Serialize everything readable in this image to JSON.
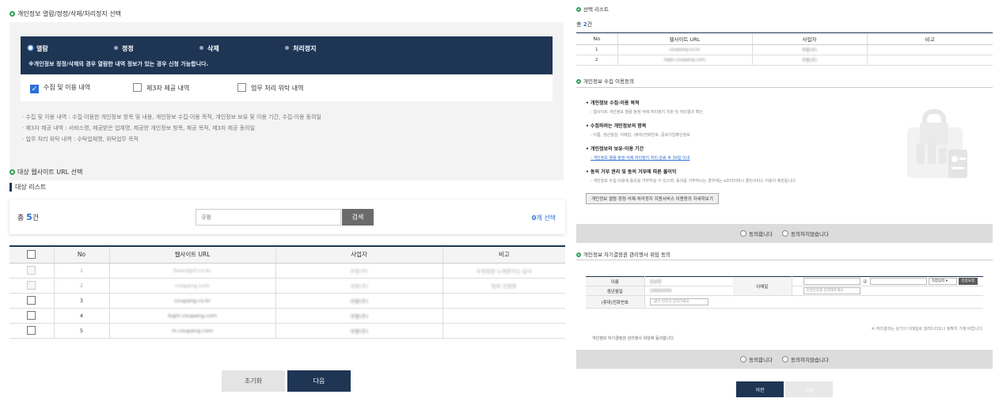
{
  "left": {
    "section1_title": "개인정보 열람/정정/삭제/처리정지 선택",
    "options": [
      "열람",
      "정정",
      "삭제",
      "처리정지"
    ],
    "notice": "※개인정보 정정/삭제의 경우 열람한 내역 정보가 있는 경우 신청 가능합니다.",
    "checks": [
      "수집 및 이용 내역",
      "제3자 제공 내역",
      "업무 처리 위탁 내역"
    ],
    "desc": [
      "· 수집 및 이용 내역 : 수집·이용한 개인정보 항목 및 내용, 개인정보 수집·이용 목적, 개인정보 보유 및 이용 기간, 수집·이용 동의일",
      "· 제3자 제공 내역 : 서비스명, 제공받은 업체명, 제공한 개인정보 항목, 제공 목적, 제3자 제공 동의일",
      "· 업무 처리 위탁 내역 : 수탁업체명, 위탁업무 목적"
    ],
    "section2_title": "대상 웹사이트 URL 선택",
    "list_title": "대상 리스트",
    "total_prefix": "총",
    "total_count": "5",
    "total_suffix": "건",
    "search_placeholder": "쿠팡",
    "search_button": "검색",
    "selected_count": "0",
    "selected_suffix": "개 선택",
    "table_headers": [
      "No",
      "웹사이트 URL",
      "사업자",
      "비고"
    ],
    "rows": [
      {
        "no": "1",
        "url": "boardgirl.co.kr",
        "biz": "쿠팡(주)",
        "note": "부정회원 노래방지도·감사"
      },
      {
        "no": "2",
        "url": "coupang.com",
        "biz": "쿠팡(주)",
        "note": "탈퇴 진행중"
      },
      {
        "no": "3",
        "url": "coupang.co.kr",
        "biz": "쿠팡(주)",
        "note": ""
      },
      {
        "no": "4",
        "url": "login.coupang.com",
        "biz": "쿠팡(주)",
        "note": ""
      },
      {
        "no": "5",
        "url": "m.coupang.com",
        "biz": "쿠팡(주)",
        "note": ""
      }
    ],
    "reset_button": "초기화",
    "next_button": "다음"
  },
  "right": {
    "selected_title": "선택 리스트",
    "total_prefix": "총",
    "total_count": "2",
    "total_suffix": "건",
    "headers": [
      "No",
      "웹사이트 URL",
      "사업자",
      "비고"
    ],
    "rows": [
      {
        "no": "1",
        "url": "coupang.co.kr",
        "biz": "쿠팡(주)",
        "note": ""
      },
      {
        "no": "2",
        "url": "login.coupang.com",
        "biz": "쿠팡(주)",
        "note": ""
      }
    ],
    "consent_title": "개인정보 수집 이용동의",
    "consent_items": [
      {
        "h": "• 개인정보 수집·이용 목적",
        "s": "- 웹사이트 개인정보 열람·정정·삭제·처리정지 지원 및 처리결과 확인"
      },
      {
        "h": "• 수집하려는 개인정보의 항목",
        "s": "- 이름, 생년월일, 이메일, (휴대)전화번호, 중복가입확인정보"
      },
      {
        "h": "• 개인정보의 보유·이용 기간",
        "s": "- 개인정보 열람·정정·삭제·처리정지 처리 완료 후 30일 이내"
      },
      {
        "h": "• 동의 거부 권리 및 동의 거부에 따른 불이익",
        "s": "- 개인정보 수집·이용에 동의를 거부하실 수 있으며, 동의를 거부하시는 경우에는 e프라이버시 클린서비스 이용이 제한됩니다."
      }
    ],
    "detail_button": "개인정보 열람·정정·삭제·처리정지 지원서비스 이용동의 자세히보기",
    "agree": "동의합니다",
    "disagree": "동의하지않습니다",
    "delegate_title": "개인정보 자기결정권 관리행사 위임 동의",
    "form": {
      "name_label": "이름",
      "name_value": "정성현",
      "birth_label": "생년월일",
      "birth_value": "19900000",
      "email_label": "이메일",
      "email_at": "@",
      "email_select": "직접입력",
      "email_btn": "인증요청",
      "auth_placeholder": "인증번호를 입력해주세요",
      "phone_label": "(휴대)전화번호",
      "phone_placeholder": "-없이 번호만 입력하세요",
      "note": "※ 처리결과는 상기의 이메일로 알려드리오니 정확히 기재 바랍니다.",
      "consent_text": "개인정보 자기결정권 관리행사 위임에 동의합니다."
    },
    "prev_button": "이전",
    "next_button": "다음"
  },
  "colors": {
    "navy": "#1e3554",
    "accent": "#2d6fd6",
    "green": "#2ea44f"
  }
}
